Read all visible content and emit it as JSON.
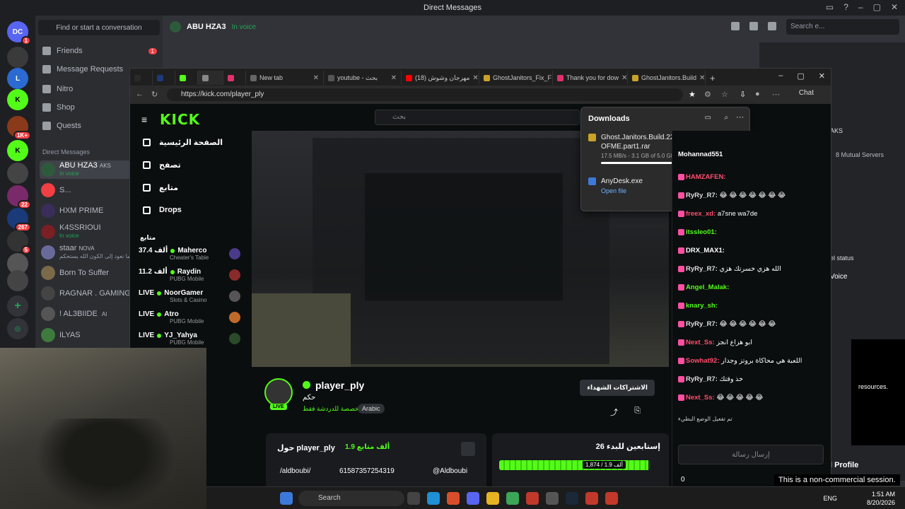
{
  "discord": {
    "title": "Direct Messages",
    "search_placeholder": "Find or start a conversation",
    "header_user": "ABU HZA3",
    "header_status": "In voice",
    "header_search": "Search e...",
    "nav": [
      {
        "label": "Friends",
        "badge": "1"
      },
      {
        "label": "Message Requests",
        "badge": ""
      },
      {
        "label": "Nitro",
        "badge": ""
      },
      {
        "label": "Shop",
        "badge": ""
      },
      {
        "label": "Quests",
        "badge": ""
      }
    ],
    "dm_header": "Direct Messages",
    "dms": [
      {
        "name": "ABU HZA3",
        "tag": "AKS",
        "sub": "In voice",
        "color": "#2e5a3c"
      },
      {
        "name": "S...",
        "tag": "",
        "sub": "",
        "color": "#5865f2"
      },
      {
        "name": "HXM PRIME",
        "tag": "",
        "sub": "",
        "color": "#3a2d5a"
      },
      {
        "name": "K4SSRIOUI",
        "tag": "",
        "sub": "In voice",
        "color": "#7a1f24"
      },
      {
        "name": "staar",
        "tag": "NOVA",
        "sub": "فيما نعود إلى الكون الله يستحكم",
        "color": "#6a6a9a"
      },
      {
        "name": "Born To Suffer",
        "tag": "",
        "sub": "",
        "color": "#7a6a4a"
      },
      {
        "name": "RAGNAR . GAMING",
        "tag": "",
        "sub": "",
        "color": "#444"
      },
      {
        "name": "! AL3BIIDE",
        "tag": "AI",
        "sub": "",
        "color": "#555"
      },
      {
        "name": "ILYAS",
        "tag": "",
        "sub": "",
        "color": "#3e7a3e"
      }
    ],
    "server_badges": [
      "1",
      "",
      "",
      "",
      "1K+",
      "",
      "",
      "22",
      "267",
      "5",
      "",
      ""
    ],
    "right_panel": {
      "name_fragment": "AKS",
      "mutual": "8 Mutual Servers",
      "status": "el status",
      "voice": "Voice",
      "resources": "resources.",
      "full_profile": "l Profile"
    }
  },
  "browser": {
    "tabs": [
      {
        "label": "",
        "color": "#2a2a2a"
      },
      {
        "label": "",
        "color": "#1d3a7a"
      },
      {
        "label": "",
        "color": "#53fc18"
      },
      {
        "label": "",
        "color": "#888"
      },
      {
        "label": "",
        "color": "#e1306c"
      },
      {
        "label": "New tab",
        "color": "#666"
      },
      {
        "label": "youtube - بحث",
        "color": "#555"
      },
      {
        "label": "(18) مهرجان وشوش",
        "color": "#ff0000"
      },
      {
        "label": "GhostJanitors_Fix_F",
        "color": "#c9a227"
      },
      {
        "label": "Thank you for dow",
        "color": "#e1306c"
      },
      {
        "label": "GhostJanitors.Build",
        "color": "#c9a227"
      }
    ],
    "url": "https://kick.com/player_ply",
    "chat_label": "Chat"
  },
  "downloads": {
    "title": "Downloads",
    "items": [
      {
        "name": "Ghost.Janitors.Build.22022026-OFME.part1.rar",
        "status": "17.5 MB/s - 3.1 GB of 5.0 GB, 2 mins left",
        "progress": 0.62,
        "link": ""
      },
      {
        "name": "AnyDesk.exe",
        "status": "",
        "progress": null,
        "link": "Open file"
      }
    ]
  },
  "kick": {
    "search_placeholder": "بحث",
    "nav": [
      {
        "label": "الصفحة الرئيسية"
      },
      {
        "label": "تصفح"
      },
      {
        "label": "متابع"
      },
      {
        "label": "Drops"
      }
    ],
    "following_header": "متابع",
    "channels": [
      {
        "viewers": "37.4 ألف",
        "name": "Maherco",
        "category": "Cheater's Table",
        "color": "#4a3a8a"
      },
      {
        "viewers": "11.2 ألف",
        "name": "Raydin",
        "category": "PUBG Mobile",
        "color": "#8a2a2a"
      },
      {
        "viewers": "LIVE",
        "name": "NoorGamer",
        "category": "Slots & Casino",
        "color": "#555"
      },
      {
        "viewers": "LIVE",
        "name": "Atro",
        "category": "PUBG Mobile",
        "color": "#c06a2a"
      },
      {
        "viewers": "LIVE",
        "name": "YJ_Yahya",
        "category": "PUBG Mobile",
        "color": "#2a4a2a"
      }
    ],
    "streamer": {
      "name": "player_ply",
      "live": "LIVE",
      "title": "حكم",
      "category": "مخصصة للدردشة فقط",
      "language": "Arabic",
      "subscribe": "الاشتراكات الشهداء"
    },
    "about": {
      "title": "حول player_ply",
      "followers": "1.9 ألف متابع",
      "links": [
        "/aldboubi/",
        "61587357254319",
        "@Aldboubi"
      ]
    },
    "goal": {
      "title": "إستابعين للبدء 26",
      "label": "1,874 / 1.9 ألف",
      "progress": 0.986
    },
    "chat_header": "Mohannad551",
    "chat": [
      {
        "user": "HAMZAFEN:",
        "text": "",
        "color": "#ff4d6d"
      },
      {
        "user": "RyRy_R7:",
        "text": "😂 😂 😂 😂 😂 😂 😂",
        "color": "#dddddd"
      },
      {
        "user": "freex_xd:",
        "text": "a7sne wa7de",
        "color": "#ff4d6d"
      },
      {
        "user": "itssleo01:",
        "text": "",
        "color": "#53fc18"
      },
      {
        "user": "DRX_MAX1:",
        "text": "",
        "color": "#ffffff"
      },
      {
        "user": "RyRy_R7:",
        "text": "الله هزي خسرتك هزي",
        "color": "#dddddd"
      },
      {
        "user": "Angel_Malak:",
        "text": "",
        "color": "#53fc18"
      },
      {
        "user": "knary_sh:",
        "text": "",
        "color": "#53fc18"
      },
      {
        "user": "RyRy_R7:",
        "text": "😂 😂 😂 😂 😂 😂",
        "color": "#dddddd"
      },
      {
        "user": "Next_Ss:",
        "text": "ابو هزاع انجز",
        "color": "#ff4d6d"
      },
      {
        "user": "Sowhat92:",
        "text": "اللعبة هي محاكاة بروتز وجدار",
        "color": "#ff4d6d"
      },
      {
        "user": "RyRy_R7:",
        "text": "خذ وقتك",
        "color": "#dddddd"
      },
      {
        "user": "Next_Ss:",
        "text": "😂 😂 😂 😂 😂",
        "color": "#ff4d6d"
      }
    ],
    "chat_notice": "تم تفعيل الوضع البطيء",
    "chat_placeholder": "إرسال رسالة",
    "points": "0"
  },
  "taskbar": {
    "search": "Search",
    "lang": "ENG",
    "time": "1:51 AM",
    "date": "8/20/2026"
  },
  "watermark": "This is a non-commercial session."
}
